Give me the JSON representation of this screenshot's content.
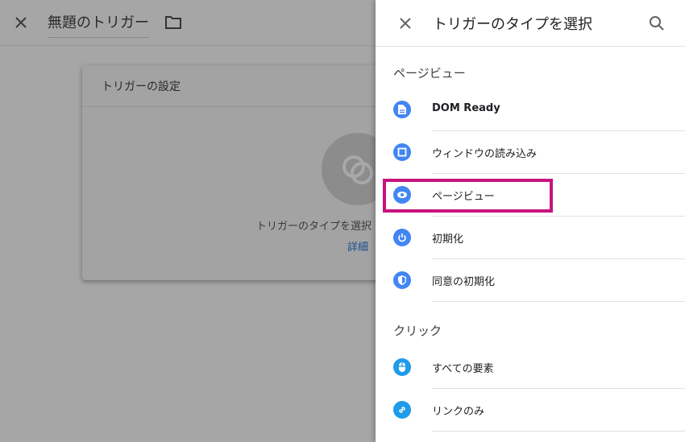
{
  "editor": {
    "title": "無題のトリガー",
    "card_heading": "トリガーの設定",
    "card_prompt": "トリガーのタイプを選択",
    "card_link": "詳細"
  },
  "panel": {
    "title": "トリガーのタイプを選択",
    "sections": [
      {
        "label": "ページビュー",
        "items": [
          {
            "label": "DOM Ready",
            "icon": "document-icon"
          },
          {
            "label": "ウィンドウの読み込み",
            "icon": "window-icon"
          },
          {
            "label": "ページビュー",
            "icon": "eye-icon"
          },
          {
            "label": "初期化",
            "icon": "power-icon"
          },
          {
            "label": "同意の初期化",
            "icon": "shield-icon"
          }
        ]
      },
      {
        "label": "クリック",
        "items": [
          {
            "label": "すべての要素",
            "icon": "mouse-icon"
          },
          {
            "label": "リンクのみ",
            "icon": "link-icon"
          }
        ]
      }
    ]
  },
  "colors": {
    "item_icon_blue": "#4285f4",
    "click_icon_blue": "#1e9be9",
    "highlight_border": "#c8127f"
  }
}
